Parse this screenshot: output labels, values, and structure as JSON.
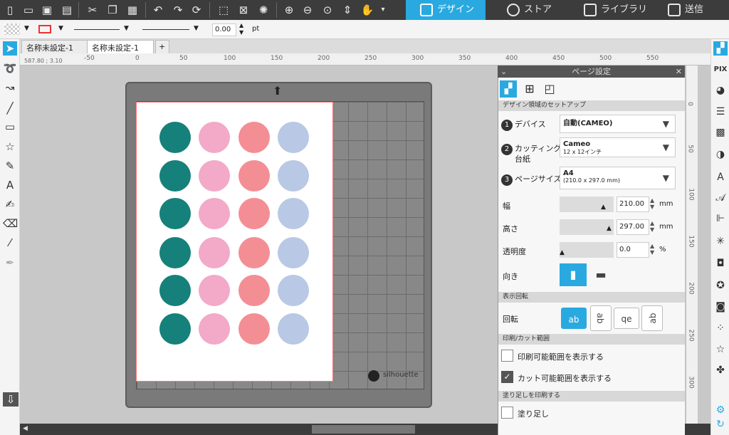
{
  "topbar": {
    "tabs": [
      {
        "label": "デザイン",
        "icon": "grid-icon"
      },
      {
        "label": "ストア",
        "icon": "silhouette-s-icon"
      },
      {
        "label": "ライブラリ",
        "icon": "download-icon"
      },
      {
        "label": "送信",
        "icon": "cutter-icon"
      }
    ]
  },
  "propbar": {
    "line_width": "0.00",
    "unit": "pt"
  },
  "doctabs": [
    {
      "label": "名称未設定-1"
    },
    {
      "label": "名称未設定-1"
    },
    {
      "label": "+"
    }
  ],
  "ruler": {
    "coords": "587.80 ; 3.10",
    "h_labels": [
      "-50",
      "0",
      "50",
      "100",
      "150",
      "200",
      "250",
      "300",
      "350",
      "400",
      "450",
      "500",
      "550"
    ],
    "v_labels": [
      "0",
      "50",
      "100",
      "150",
      "200",
      "250",
      "300"
    ]
  },
  "mat": {
    "brand": "silhouette"
  },
  "stickers": [
    [
      "teal",
      "pink",
      "coral",
      "blue"
    ],
    [
      "teal",
      "pink",
      "coral",
      "blue"
    ],
    [
      "teal",
      "pink",
      "coral",
      "blue"
    ],
    [
      "teal",
      "pink",
      "coral",
      "blue"
    ],
    [
      "teal",
      "pink",
      "coral",
      "blue"
    ],
    [
      "teal",
      "pink",
      "coral",
      "blue"
    ]
  ],
  "panel": {
    "title": "ページ設定",
    "sec_setup": "デザイン領域のセットアップ",
    "device_label": "デバイス",
    "device_value": "自動(CAMEO)",
    "mat_label1": "カッティング用",
    "mat_label2": "台紙",
    "mat_value": "Cameo",
    "mat_sub": "12 x 12インチ",
    "page_label": "ページサイズ",
    "page_value": "A4",
    "page_sub": "(210.0 x 297.0 mm)",
    "width_label": "幅",
    "width_value": "210.00",
    "height_label": "高さ",
    "height_value": "297.00",
    "unit_mm": "mm",
    "trans_label": "透明度",
    "trans_value": "0.0",
    "trans_unit": "%",
    "orient_label": "向き",
    "sec_rotate": "表示回転",
    "rotate_label": "回転",
    "rotate_opts": [
      "ab",
      "ab",
      "qe",
      "ab"
    ],
    "sec_print": "印刷/カット範囲",
    "print_area": "印刷可能範囲を表示する",
    "cut_area": "カット可能範囲を表示する",
    "sec_bleed": "塗り足しを印刷する",
    "bleed": "塗り足し"
  }
}
